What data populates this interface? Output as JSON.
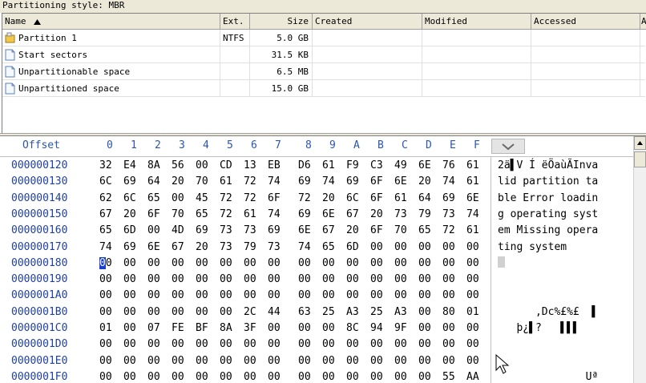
{
  "style_bar": "Partitioning style: MBR",
  "columns": {
    "name": "Name",
    "sort_icon": "sort-up-icon",
    "ext": "Ext.",
    "size": "Size",
    "created": "Created",
    "modified": "Modified",
    "accessed": "Accessed",
    "attr": "A"
  },
  "files": [
    {
      "name": "Partition 1",
      "ext": "NTFS",
      "size": "5.0 GB",
      "icon": "partition-icon"
    },
    {
      "name": "Start sectors",
      "ext": "",
      "size": "31.5 KB",
      "icon": "file-icon"
    },
    {
      "name": "Unpartitionable space",
      "ext": "",
      "size": "6.5 MB",
      "icon": "file-icon"
    },
    {
      "name": "Unpartitioned space",
      "ext": "",
      "size": "15.0 GB",
      "icon": "file-icon"
    }
  ],
  "hex": {
    "offset_label": "Offset",
    "columns": [
      "0",
      "1",
      "2",
      "3",
      "4",
      "5",
      "6",
      "7",
      "8",
      "9",
      "A",
      "B",
      "C",
      "D",
      "E",
      "F"
    ],
    "rows": [
      {
        "offset": "000000120",
        "bytes": [
          "32",
          "E4",
          "8A",
          "56",
          "00",
          "CD",
          "13",
          "EB",
          "D6",
          "61",
          "F9",
          "C3",
          "49",
          "6E",
          "76",
          "61"
        ],
        "ascii": "2ä▌V Í ëÖaùÃInva"
      },
      {
        "offset": "000000130",
        "bytes": [
          "6C",
          "69",
          "64",
          "20",
          "70",
          "61",
          "72",
          "74",
          "69",
          "74",
          "69",
          "6F",
          "6E",
          "20",
          "74",
          "61"
        ],
        "ascii": "lid partition ta"
      },
      {
        "offset": "000000140",
        "bytes": [
          "62",
          "6C",
          "65",
          "00",
          "45",
          "72",
          "72",
          "6F",
          "72",
          "20",
          "6C",
          "6F",
          "61",
          "64",
          "69",
          "6E"
        ],
        "ascii": "ble Error loadin"
      },
      {
        "offset": "000000150",
        "bytes": [
          "67",
          "20",
          "6F",
          "70",
          "65",
          "72",
          "61",
          "74",
          "69",
          "6E",
          "67",
          "20",
          "73",
          "79",
          "73",
          "74"
        ],
        "ascii": "g operating syst"
      },
      {
        "offset": "000000160",
        "bytes": [
          "65",
          "6D",
          "00",
          "4D",
          "69",
          "73",
          "73",
          "69",
          "6E",
          "67",
          "20",
          "6F",
          "70",
          "65",
          "72",
          "61"
        ],
        "ascii": "em Missing opera"
      },
      {
        "offset": "000000170",
        "bytes": [
          "74",
          "69",
          "6E",
          "67",
          "20",
          "73",
          "79",
          "73",
          "74",
          "65",
          "6D",
          "00",
          "00",
          "00",
          "00",
          "00"
        ],
        "ascii": "ting system"
      },
      {
        "offset": "000000180",
        "bytes": [
          "00",
          "00",
          "00",
          "00",
          "00",
          "00",
          "00",
          "00",
          "00",
          "00",
          "00",
          "00",
          "00",
          "00",
          "00",
          "00"
        ],
        "ascii": ""
      },
      {
        "offset": "000000190",
        "bytes": [
          "00",
          "00",
          "00",
          "00",
          "00",
          "00",
          "00",
          "00",
          "00",
          "00",
          "00",
          "00",
          "00",
          "00",
          "00",
          "00"
        ],
        "ascii": ""
      },
      {
        "offset": "0000001A0",
        "bytes": [
          "00",
          "00",
          "00",
          "00",
          "00",
          "00",
          "00",
          "00",
          "00",
          "00",
          "00",
          "00",
          "00",
          "00",
          "00",
          "00"
        ],
        "ascii": ""
      },
      {
        "offset": "0000001B0",
        "bytes": [
          "00",
          "00",
          "00",
          "00",
          "00",
          "00",
          "2C",
          "44",
          "63",
          "25",
          "A3",
          "25",
          "A3",
          "00",
          "80",
          "01"
        ],
        "ascii": "      ,Dc%£%£  ▌"
      },
      {
        "offset": "0000001C0",
        "bytes": [
          "01",
          "00",
          "07",
          "FE",
          "BF",
          "8A",
          "3F",
          "00",
          "00",
          "00",
          "8C",
          "94",
          "9F",
          "00",
          "00",
          "00"
        ],
        "ascii": "   þ¿▌?   ▌▌▌"
      },
      {
        "offset": "0000001D0",
        "bytes": [
          "00",
          "00",
          "00",
          "00",
          "00",
          "00",
          "00",
          "00",
          "00",
          "00",
          "00",
          "00",
          "00",
          "00",
          "00",
          "00"
        ],
        "ascii": ""
      },
      {
        "offset": "0000001E0",
        "bytes": [
          "00",
          "00",
          "00",
          "00",
          "00",
          "00",
          "00",
          "00",
          "00",
          "00",
          "00",
          "00",
          "00",
          "00",
          "00",
          "00"
        ],
        "ascii": ""
      },
      {
        "offset": "0000001F0",
        "bytes": [
          "00",
          "00",
          "00",
          "00",
          "00",
          "00",
          "00",
          "00",
          "00",
          "00",
          "00",
          "00",
          "00",
          "00",
          "55",
          "AA"
        ],
        "ascii": "              Uª"
      }
    ]
  },
  "colors": {
    "offset_blue": "#1e3fa8",
    "header_blue": "#2a55b0",
    "cursor": "#1a3fcf",
    "chrome": "#ece9d8"
  }
}
